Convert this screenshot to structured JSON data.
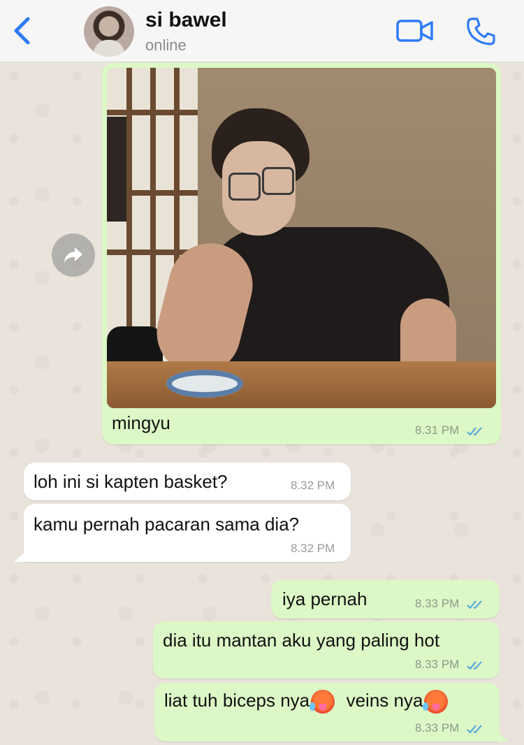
{
  "header": {
    "contact_name": "si bawel",
    "status": "online",
    "back_icon": "chevron-left-icon",
    "video_icon": "video-camera-icon",
    "call_icon": "phone-icon",
    "accent_color": "#2F7BF6"
  },
  "messages": [
    {
      "direction": "out",
      "type": "image",
      "caption": "mingyu",
      "time": "8.31 PM",
      "read": true
    },
    {
      "direction": "in",
      "text": "loh ini si kapten basket?",
      "time": "8.32 PM"
    },
    {
      "direction": "in",
      "text": "kamu pernah pacaran sama dia?",
      "time": "8.32 PM"
    },
    {
      "direction": "out",
      "text": "iya pernah",
      "time": "8.33 PM",
      "read": true
    },
    {
      "direction": "out",
      "text": "dia itu mantan aku yang paling hot",
      "time": "8.33 PM",
      "read": true
    },
    {
      "direction": "out",
      "text_parts": [
        "liat tuh biceps nya",
        "veins nya"
      ],
      "emoji": "hot-face-emoji",
      "time": "8.33 PM",
      "read": true
    }
  ],
  "colors": {
    "outgoing_bubble": "#DCF8C6",
    "incoming_bubble": "#FFFFFF",
    "read_ticks": "#4FA3E0",
    "chat_background": "#E9E3DB"
  }
}
